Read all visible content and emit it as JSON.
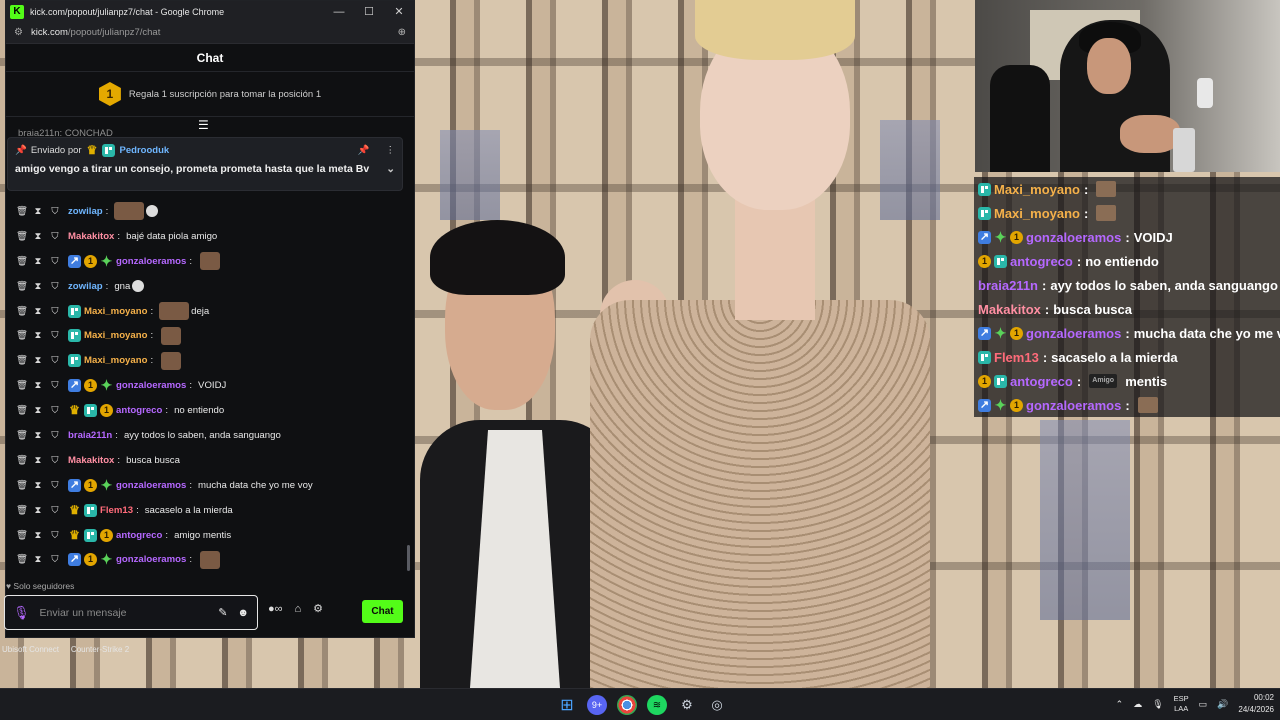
{
  "window": {
    "title": "kick.com/popout/julianpz7/chat - Google Chrome",
    "minimize": "—",
    "maximize": "☐",
    "close": "✕"
  },
  "address": {
    "host": "kick.com",
    "path": "/popout/julianpz7/chat"
  },
  "chat": {
    "header": "Chat",
    "sub_goal": {
      "position": "1",
      "text": "Regala 1 suscripción para tomar la posición 1"
    },
    "cutoff_line": "braia211n: CONCHAD",
    "pinned": {
      "label": "Enviado por",
      "user": "Pedrooduk",
      "message": "amigo vengo a tirar un consejo, prometa prometa hasta que la meta Bv"
    },
    "messages": [
      {
        "badges": [],
        "user": "zowilap",
        "color": "#6fb6ff",
        "text": "",
        "emote": "emote-wide-cat"
      },
      {
        "badges": [],
        "user": "Makakitox",
        "color": "#ff8fa3",
        "text": "bajé data piola amigo",
        "emote": ""
      },
      {
        "badges": [
          "vip",
          "sub",
          "spark"
        ],
        "user": "gonzaloeramos",
        "color": "#b568ff",
        "text": "",
        "emote": "emote"
      },
      {
        "badges": [],
        "user": "zowilap",
        "color": "#6fb6ff",
        "text": "gna",
        "emote": "emote-cat-after"
      },
      {
        "badges": [
          "og"
        ],
        "user": "Maxi_moyano",
        "color": "#f5b14a",
        "text": "deja",
        "emote": "emote-wide-before"
      },
      {
        "badges": [
          "og"
        ],
        "user": "Maxi_moyano",
        "color": "#f5b14a",
        "text": "",
        "emote": "emote"
      },
      {
        "badges": [
          "og"
        ],
        "user": "Maxi_moyano",
        "color": "#f5b14a",
        "text": "",
        "emote": "emote"
      },
      {
        "badges": [
          "vip",
          "sub",
          "spark"
        ],
        "user": "gonzaloeramos",
        "color": "#b568ff",
        "text": "VOIDJ",
        "emote": ""
      },
      {
        "badges": [
          "crown",
          "og",
          "sub"
        ],
        "user": "antogreco",
        "color": "#b568ff",
        "text": "no entiendo",
        "emote": ""
      },
      {
        "badges": [],
        "user": "braia211n",
        "color": "#b568ff",
        "text": "ayy todos lo saben, anda sanguango",
        "emote": ""
      },
      {
        "badges": [],
        "user": "Makakitox",
        "color": "#ff8fa3",
        "text": "busca busca",
        "emote": ""
      },
      {
        "badges": [
          "vip",
          "sub",
          "spark"
        ],
        "user": "gonzaloeramos",
        "color": "#b568ff",
        "text": "mucha data che yo me voy",
        "emote": ""
      },
      {
        "badges": [
          "crown",
          "og"
        ],
        "user": "Flem13",
        "color": "#ff6b7a",
        "text": "sacaselo a la mierda",
        "emote": ""
      },
      {
        "badges": [
          "crown",
          "og",
          "sub"
        ],
        "user": "antogreco",
        "color": "#b568ff",
        "text": "amigo mentis",
        "emote": ""
      },
      {
        "badges": [
          "vip",
          "sub",
          "spark"
        ],
        "user": "gonzaloeramos",
        "color": "#b568ff",
        "text": "",
        "emote": "emote"
      }
    ],
    "followers_only": "Solo seguidores",
    "input_placeholder": "Enviar un mensaje",
    "send_label": "Chat"
  },
  "overlay_chat": [
    {
      "badges": [
        "og"
      ],
      "user": "Maxi_moyano",
      "color": "#f5b14a",
      "text": "",
      "emote": "thumb"
    },
    {
      "badges": [
        "og"
      ],
      "user": "Maxi_moyano",
      "color": "#f5b14a",
      "text": "",
      "emote": "thumb"
    },
    {
      "badges": [
        "vip",
        "spark",
        "sub"
      ],
      "user": "gonzaloeramos",
      "color": "#b568ff",
      "text": "VOIDJ",
      "emote": ""
    },
    {
      "badges": [
        "sub",
        "og"
      ],
      "user": "antogreco",
      "color": "#b568ff",
      "text": "no entiendo",
      "emote": ""
    },
    {
      "badges": [],
      "user": "braia211n",
      "color": "#b568ff",
      "text": "ayy todos lo saben, anda sanguango",
      "emote": ""
    },
    {
      "badges": [],
      "user": "Makakitox",
      "color": "#ff8fa3",
      "text": "busca busca",
      "emote": ""
    },
    {
      "badges": [
        "vip",
        "spark",
        "sub"
      ],
      "user": "gonzaloeramos",
      "color": "#b568ff",
      "text": "mucha data che yo me voy",
      "emote": ""
    },
    {
      "badges": [
        "og"
      ],
      "user": "Flem13",
      "color": "#ff6b7a",
      "text": "sacaselo a la mierda",
      "emote": ""
    },
    {
      "badges": [
        "sub",
        "og"
      ],
      "user": "antogreco",
      "color": "#b568ff",
      "text": "mentis",
      "emote": "tag"
    },
    {
      "badges": [
        "vip",
        "spark",
        "sub"
      ],
      "user": "gonzaloeramos",
      "color": "#b568ff",
      "text": "",
      "emote": "thumb"
    }
  ],
  "desktop": {
    "items": [
      "Ubisoft Connect",
      "Counter-Strike 2"
    ]
  },
  "taskbar": {
    "discord_badge": "9+",
    "lang_top": "ESP",
    "lang_bottom": "LAA",
    "time": "00:02",
    "date": "24/4/2026"
  },
  "colors": {
    "kick_green": "#53fc18",
    "mic_purple": "#b568ff"
  }
}
